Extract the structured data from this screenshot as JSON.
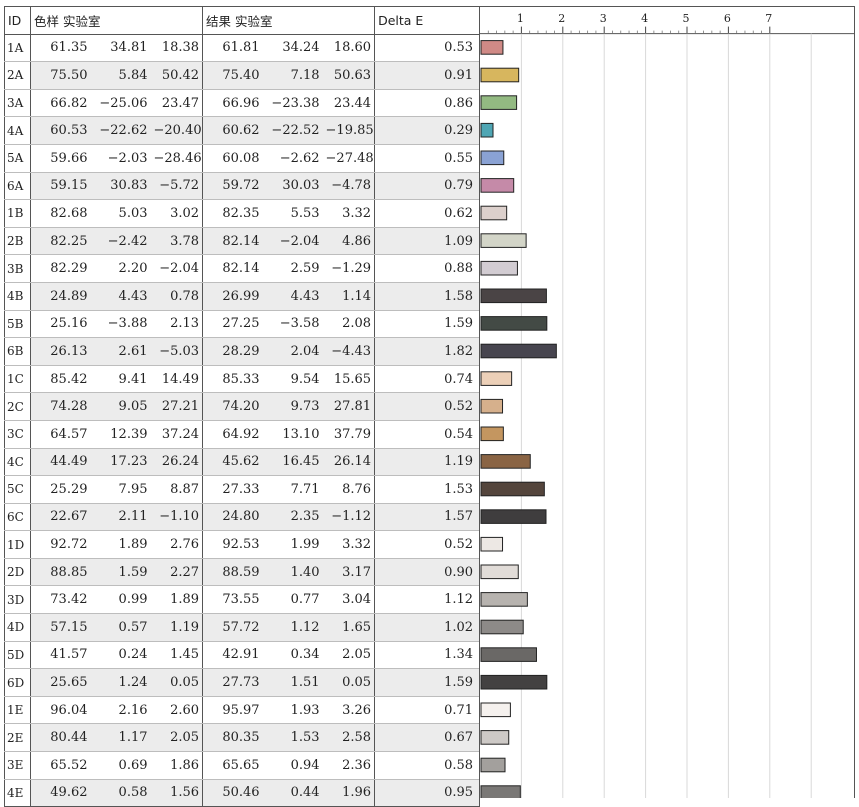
{
  "headers": {
    "id": "ID",
    "sample": "色样 实验室",
    "result": "结果 实验室",
    "delta_e": "Delta E"
  },
  "rows": [
    {
      "id": "1A",
      "sample": [
        "61.35",
        "34.81",
        "18.38"
      ],
      "result": [
        "61.81",
        "34.24",
        "18.60"
      ],
      "de": "0.53",
      "color": "#d08a86"
    },
    {
      "id": "2A",
      "sample": [
        "75.50",
        "5.84",
        "50.42"
      ],
      "result": [
        "75.40",
        "7.18",
        "50.63"
      ],
      "de": "0.91",
      "color": "#d7b65e"
    },
    {
      "id": "3A",
      "sample": [
        "66.82",
        "−25.06",
        "23.47"
      ],
      "result": [
        "66.96",
        "−23.38",
        "23.44"
      ],
      "de": "0.86",
      "color": "#93ba82"
    },
    {
      "id": "4A",
      "sample": [
        "60.53",
        "−22.62",
        "−20.40"
      ],
      "result": [
        "60.62",
        "−22.52",
        "−19.85"
      ],
      "de": "0.29",
      "color": "#4fa6b4"
    },
    {
      "id": "5A",
      "sample": [
        "59.66",
        "−2.03",
        "−28.46"
      ],
      "result": [
        "60.08",
        "−2.62",
        "−27.48"
      ],
      "de": "0.55",
      "color": "#8aa2d4"
    },
    {
      "id": "6A",
      "sample": [
        "59.15",
        "30.83",
        "−5.72"
      ],
      "result": [
        "59.72",
        "30.03",
        "−4.78"
      ],
      "de": "0.79",
      "color": "#c58aa8"
    },
    {
      "id": "1B",
      "sample": [
        "82.68",
        "5.03",
        "3.02"
      ],
      "result": [
        "82.35",
        "5.53",
        "3.32"
      ],
      "de": "0.62",
      "color": "#dcd0cc"
    },
    {
      "id": "2B",
      "sample": [
        "82.25",
        "−2.42",
        "3.78"
      ],
      "result": [
        "82.14",
        "−2.04",
        "4.86"
      ],
      "de": "1.09",
      "color": "#d3d5c8"
    },
    {
      "id": "3B",
      "sample": [
        "82.29",
        "2.20",
        "−2.04"
      ],
      "result": [
        "82.14",
        "2.59",
        "−1.29"
      ],
      "de": "0.88",
      "color": "#d2ccd2"
    },
    {
      "id": "4B",
      "sample": [
        "24.89",
        "4.43",
        "0.78"
      ],
      "result": [
        "26.99",
        "4.43",
        "1.14"
      ],
      "de": "1.58",
      "color": "#4a4445"
    },
    {
      "id": "5B",
      "sample": [
        "25.16",
        "−3.88",
        "2.13"
      ],
      "result": [
        "27.25",
        "−3.58",
        "2.08"
      ],
      "de": "1.59",
      "color": "#434a45"
    },
    {
      "id": "6B",
      "sample": [
        "26.13",
        "2.61",
        "−5.03"
      ],
      "result": [
        "28.29",
        "2.04",
        "−4.43"
      ],
      "de": "1.82",
      "color": "#47454f"
    },
    {
      "id": "1C",
      "sample": [
        "85.42",
        "9.41",
        "14.49"
      ],
      "result": [
        "85.33",
        "9.54",
        "15.65"
      ],
      "de": "0.74",
      "color": "#ecd0b8"
    },
    {
      "id": "2C",
      "sample": [
        "74.28",
        "9.05",
        "27.21"
      ],
      "result": [
        "74.20",
        "9.73",
        "27.81"
      ],
      "de": "0.52",
      "color": "#d6b08c"
    },
    {
      "id": "3C",
      "sample": [
        "64.57",
        "12.39",
        "37.24"
      ],
      "result": [
        "64.92",
        "13.10",
        "37.79"
      ],
      "de": "0.54",
      "color": "#c49660"
    },
    {
      "id": "4C",
      "sample": [
        "44.49",
        "17.23",
        "26.24"
      ],
      "result": [
        "45.62",
        "16.45",
        "26.14"
      ],
      "de": "1.19",
      "color": "#8a6444"
    },
    {
      "id": "5C",
      "sample": [
        "25.29",
        "7.95",
        "8.87"
      ],
      "result": [
        "27.33",
        "7.71",
        "8.76"
      ],
      "de": "1.53",
      "color": "#54453c"
    },
    {
      "id": "6C",
      "sample": [
        "22.67",
        "2.11",
        "−1.10"
      ],
      "result": [
        "24.80",
        "2.35",
        "−1.12"
      ],
      "de": "1.57",
      "color": "#3f3d3e"
    },
    {
      "id": "1D",
      "sample": [
        "92.72",
        "1.89",
        "2.76"
      ],
      "result": [
        "92.53",
        "1.99",
        "3.32"
      ],
      "de": "0.52",
      "color": "#ede8e4"
    },
    {
      "id": "2D",
      "sample": [
        "88.85",
        "1.59",
        "2.27"
      ],
      "result": [
        "88.59",
        "1.40",
        "3.17"
      ],
      "de": "0.90",
      "color": "#e1dcd8"
    },
    {
      "id": "3D",
      "sample": [
        "73.42",
        "0.99",
        "1.89"
      ],
      "result": [
        "73.55",
        "0.77",
        "3.04"
      ],
      "de": "1.12",
      "color": "#b7b3af"
    },
    {
      "id": "4D",
      "sample": [
        "57.15",
        "0.57",
        "1.19"
      ],
      "result": [
        "57.72",
        "1.12",
        "1.65"
      ],
      "de": "1.02",
      "color": "#8d8a88"
    },
    {
      "id": "5D",
      "sample": [
        "41.57",
        "0.24",
        "1.45"
      ],
      "result": [
        "42.91",
        "0.34",
        "2.05"
      ],
      "de": "1.34",
      "color": "#6a6866"
    },
    {
      "id": "6D",
      "sample": [
        "25.65",
        "1.24",
        "0.05"
      ],
      "result": [
        "27.73",
        "1.51",
        "0.05"
      ],
      "de": "1.59",
      "color": "#434141"
    },
    {
      "id": "1E",
      "sample": [
        "96.04",
        "2.16",
        "2.60"
      ],
      "result": [
        "95.97",
        "1.93",
        "3.26"
      ],
      "de": "0.71",
      "color": "#f5f1ee"
    },
    {
      "id": "2E",
      "sample": [
        "80.44",
        "1.17",
        "2.05"
      ],
      "result": [
        "80.35",
        "1.53",
        "2.58"
      ],
      "de": "0.67",
      "color": "#cdc9c6"
    },
    {
      "id": "3E",
      "sample": [
        "65.52",
        "0.69",
        "1.86"
      ],
      "result": [
        "65.65",
        "0.94",
        "2.36"
      ],
      "de": "0.58",
      "color": "#a3a09d"
    },
    {
      "id": "4E",
      "sample": [
        "49.62",
        "0.58",
        "1.56"
      ],
      "result": [
        "50.46",
        "0.44",
        "1.96"
      ],
      "de": "0.95",
      "color": "#7a7876"
    }
  ],
  "chart_data": {
    "type": "bar",
    "orientation": "horizontal",
    "categories": [
      "1A",
      "2A",
      "3A",
      "4A",
      "5A",
      "6A",
      "1B",
      "2B",
      "3B",
      "4B",
      "5B",
      "6B",
      "1C",
      "2C",
      "3C",
      "4C",
      "5C",
      "6C",
      "1D",
      "2D",
      "3D",
      "4D",
      "5D",
      "6D",
      "1E",
      "2E",
      "3E",
      "4E"
    ],
    "values": [
      0.53,
      0.91,
      0.86,
      0.29,
      0.55,
      0.79,
      0.62,
      1.09,
      0.88,
      1.58,
      1.59,
      1.82,
      0.74,
      0.52,
      0.54,
      1.19,
      1.53,
      1.57,
      0.52,
      0.9,
      1.12,
      1.02,
      1.34,
      1.59,
      0.71,
      0.67,
      0.58,
      0.95
    ],
    "tick_labels": [
      "1",
      "2",
      "3",
      "4",
      "5",
      "6",
      "7"
    ],
    "xlim": [
      0,
      8
    ],
    "grid": true
  }
}
